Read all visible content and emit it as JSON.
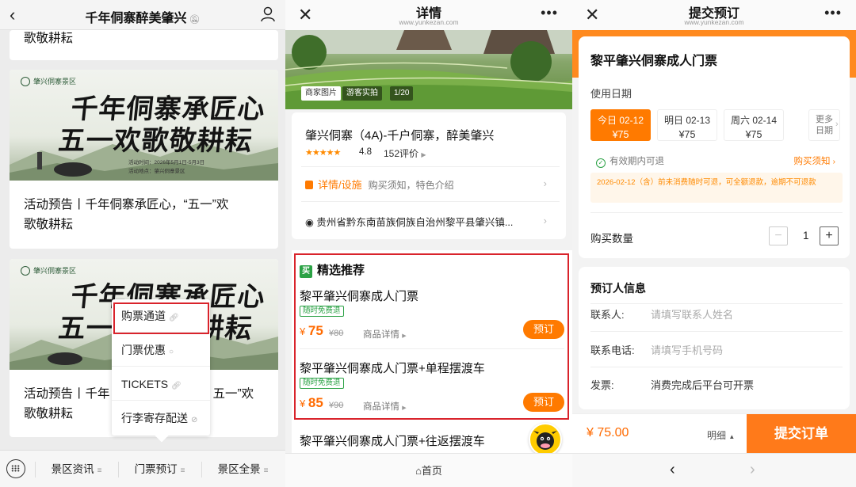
{
  "panel1": {
    "title": "千年侗寨醉美肇兴",
    "mute_icon": "bell-off-icon",
    "top_card_tail": "歌敬耕耘",
    "posters": [
      {
        "logo_text": "肇兴侗寨景区",
        "calligraphy": [
          "千年侗寨承匠心",
          "五一欢歌敬耕耘"
        ],
        "info": [
          "活动时间：2026年5月1日-5月3日",
          "活动地点：肇兴侗寨景区"
        ]
      },
      {
        "logo_text": "肇兴侗寨景区",
        "calligraphy": [
          "千年侗寨承匠心",
          "五一欢歌敬耕耘"
        ]
      }
    ],
    "article_title_1a": "活动预告丨千年侗寨承匠心，“五一”欢",
    "article_title_1b": "歌敬耕耘",
    "article_title_2a_left": "活动预告丨千年",
    "article_title_2a_right": "五一”欢",
    "article_title_2b": "歌敬耕耘",
    "popup": [
      {
        "label": "购票通道",
        "icon": "link-icon"
      },
      {
        "label": "门票优惠",
        "icon": "chat-icon"
      },
      {
        "label": "TICKETS",
        "icon": "link-icon"
      },
      {
        "label": "行李寄存配送",
        "icon": "miniprogram-icon"
      }
    ],
    "bottom_menu": [
      "景区资讯",
      "门票预订",
      "景区全景"
    ]
  },
  "panel2": {
    "header_title": "详情",
    "header_sub": "www.yunkezan.com",
    "photo_labels": [
      "商家图片",
      "游客实拍",
      "1/20"
    ],
    "scenic_name": "肇兴侗寨（4A)-千户侗寨，醉美肇兴",
    "score": "4.8",
    "reviews": "152评价",
    "facility_label": "详情/设施",
    "facility_sub": "购买须知，特色介绍",
    "address": "贵州省黔东南苗族侗族自治州黎平县肇兴镇...",
    "rec_badge": "买",
    "rec_title": "精选推荐",
    "tickets": [
      {
        "name": "黎平肇兴侗寨成人门票",
        "tag": "随时免费退",
        "price": "75",
        "old": "¥80",
        "detail": "商品详情",
        "btn": "预订"
      },
      {
        "name": "黎平肇兴侗寨成人门票+单程摆渡车",
        "tag": "随时免费退",
        "price": "85",
        "old": "¥90",
        "detail": "商品详情",
        "btn": "预订"
      },
      {
        "name": "黎平肇兴侗寨成人门票+往返摆渡车"
      }
    ],
    "currency": "¥",
    "home_label": "首页"
  },
  "panel3": {
    "header_title": "提交预订",
    "header_sub": "www.yunkezan.com",
    "ticket_title": "黎平肇兴侗寨成人门票",
    "date_label": "使用日期",
    "dates": [
      {
        "day": "今日 02-12",
        "price": "¥75"
      },
      {
        "day": "明日 02-13",
        "price": "¥75"
      },
      {
        "day": "周六 02-14",
        "price": "¥75"
      }
    ],
    "more_dates": [
      "更多",
      "日期"
    ],
    "refund_text": "有效期内可退",
    "notice_link": "购买须知",
    "notice_text": "2026-02-12（含）前未消费随时可退，可全额退款，逾期不可退款",
    "qty_label": "购买数量",
    "qty": "1",
    "booker_title": "预订人信息",
    "fields": [
      {
        "label": "联系人:",
        "value": "请填写联系人姓名"
      },
      {
        "label": "联系电话:",
        "value": "请填写手机号码"
      },
      {
        "label": "发票:",
        "value": "消费完成后平台可开票"
      }
    ],
    "total": "¥ 75.00",
    "detail_label": "明细",
    "submit_label": "提交订单"
  },
  "colors": {
    "accent": "#ff7a00",
    "highlight": "#d9232b",
    "green": "#2ba245"
  }
}
